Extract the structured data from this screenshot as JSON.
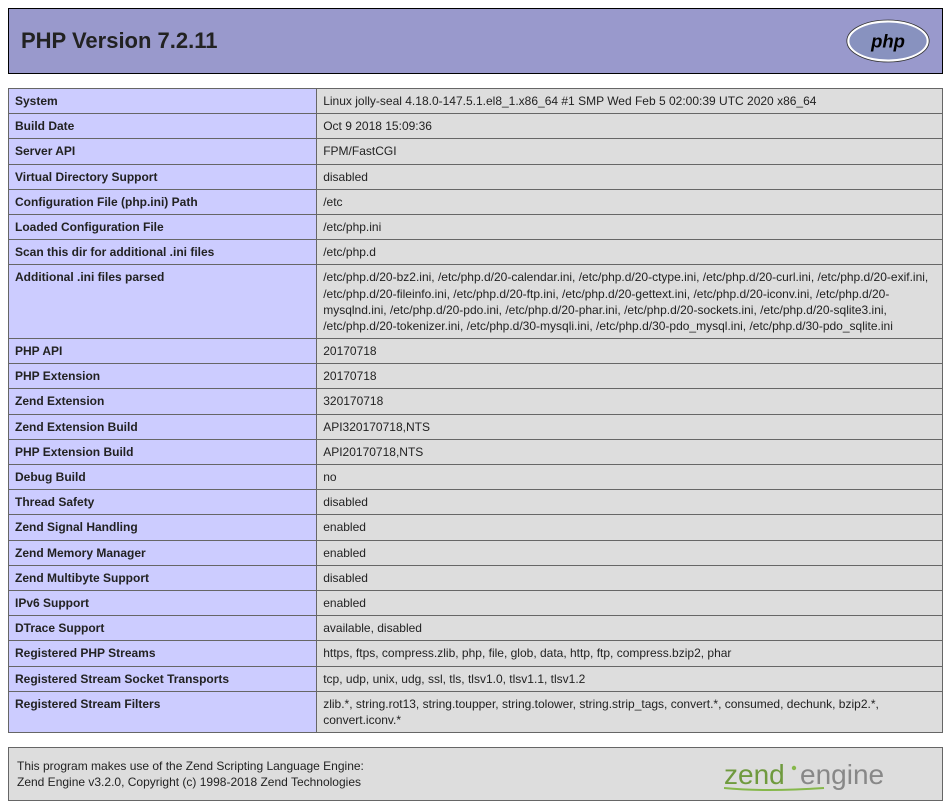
{
  "header": {
    "title": "PHP Version 7.2.11"
  },
  "rows": [
    {
      "k": "System",
      "v": "Linux jolly-seal 4.18.0-147.5.1.el8_1.x86_64 #1 SMP Wed Feb 5 02:00:39 UTC 2020 x86_64"
    },
    {
      "k": "Build Date",
      "v": "Oct 9 2018 15:09:36"
    },
    {
      "k": "Server API",
      "v": "FPM/FastCGI"
    },
    {
      "k": "Virtual Directory Support",
      "v": "disabled"
    },
    {
      "k": "Configuration File (php.ini) Path",
      "v": "/etc"
    },
    {
      "k": "Loaded Configuration File",
      "v": "/etc/php.ini"
    },
    {
      "k": "Scan this dir for additional .ini files",
      "v": "/etc/php.d"
    },
    {
      "k": "Additional .ini files parsed",
      "v": "/etc/php.d/20-bz2.ini, /etc/php.d/20-calendar.ini, /etc/php.d/20-ctype.ini, /etc/php.d/20-curl.ini, /etc/php.d/20-exif.ini, /etc/php.d/20-fileinfo.ini, /etc/php.d/20-ftp.ini, /etc/php.d/20-gettext.ini, /etc/php.d/20-iconv.ini, /etc/php.d/20-mysqlnd.ini, /etc/php.d/20-pdo.ini, /etc/php.d/20-phar.ini, /etc/php.d/20-sockets.ini, /etc/php.d/20-sqlite3.ini, /etc/php.d/20-tokenizer.ini, /etc/php.d/30-mysqli.ini, /etc/php.d/30-pdo_mysql.ini, /etc/php.d/30-pdo_sqlite.ini"
    },
    {
      "k": "PHP API",
      "v": "20170718"
    },
    {
      "k": "PHP Extension",
      "v": "20170718"
    },
    {
      "k": "Zend Extension",
      "v": "320170718"
    },
    {
      "k": "Zend Extension Build",
      "v": "API320170718,NTS"
    },
    {
      "k": "PHP Extension Build",
      "v": "API20170718,NTS"
    },
    {
      "k": "Debug Build",
      "v": "no"
    },
    {
      "k": "Thread Safety",
      "v": "disabled"
    },
    {
      "k": "Zend Signal Handling",
      "v": "enabled"
    },
    {
      "k": "Zend Memory Manager",
      "v": "enabled"
    },
    {
      "k": "Zend Multibyte Support",
      "v": "disabled"
    },
    {
      "k": "IPv6 Support",
      "v": "enabled"
    },
    {
      "k": "DTrace Support",
      "v": "available, disabled"
    },
    {
      "k": "Registered PHP Streams",
      "v": "https, ftps, compress.zlib, php, file, glob, data, http, ftp, compress.bzip2, phar"
    },
    {
      "k": "Registered Stream Socket Transports",
      "v": "tcp, udp, unix, udg, ssl, tls, tlsv1.0, tlsv1.1, tlsv1.2"
    },
    {
      "k": "Registered Stream Filters",
      "v": "zlib.*, string.rot13, string.toupper, string.tolower, string.strip_tags, convert.*, consumed, dechunk, bzip2.*, convert.iconv.*"
    }
  ],
  "footer": {
    "line1": "This program makes use of the Zend Scripting Language Engine:",
    "line2": "Zend Engine v3.2.0, Copyright (c) 1998-2018 Zend Technologies"
  }
}
